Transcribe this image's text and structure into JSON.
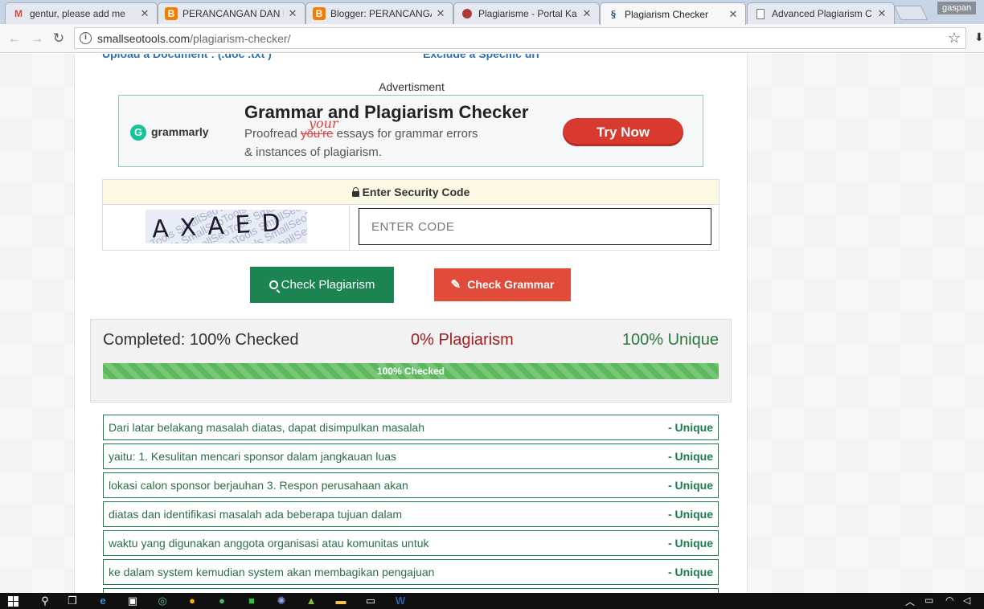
{
  "browser": {
    "tabs": [
      {
        "title": "gentur, please add me",
        "icon": "gmail-icon",
        "active": false
      },
      {
        "title": "PERANCANGAN DAN I",
        "icon": "blogger-icon",
        "active": false
      },
      {
        "title": "Blogger: PERANCANGA",
        "icon": "blogger-icon",
        "active": false
      },
      {
        "title": "Plagiarisme - Portal Ka",
        "icon": "portal-icon",
        "active": false
      },
      {
        "title": "Plagiarism Checker",
        "icon": "smallseotools-icon",
        "active": true
      },
      {
        "title": "Advanced Plagiarism C",
        "icon": "page-icon",
        "active": false
      }
    ],
    "profile_name": "gaspan",
    "url_host": "smallseotools.com",
    "url_path": "/plagiarism-checker/"
  },
  "page": {
    "upload_link": "Upload a Document : (.doc .txt )",
    "exclude_link": "Exclude a Specific url",
    "advert_label": "Advertisment",
    "ad": {
      "brand": "grammarly",
      "logo_letter": "G",
      "headline": "Grammar and Plagiarism Checker",
      "body_start": "Proofread ",
      "struck_word": "you're",
      "handwritten_word": "your",
      "body_end": " essays for grammar errors",
      "body_line2": "& instances of plagiarism.",
      "cta": "Try Now"
    },
    "security": {
      "title": "Enter Security Code",
      "captcha_code": "AXAED",
      "captcha_watermark": "SmallSeoTools",
      "placeholder": "ENTER CODE"
    },
    "buttons": {
      "check_plagiarism": "Check Plagiarism",
      "check_grammar": "Check Grammar"
    },
    "results": {
      "completed": "Completed: 100% Checked",
      "plagiarism": "0% Plagiarism",
      "unique": "100% Unique",
      "progress_label": "100% Checked",
      "progress_percent": 100
    },
    "sentences": [
      {
        "text": "Dari latar belakang masalah diatas, dapat disimpulkan masalah",
        "status": "- Unique"
      },
      {
        "text": "yaitu: 1. Kesulitan mencari sponsor dalam jangkauan luas",
        "status": "- Unique"
      },
      {
        "text": "lokasi calon sponsor berjauhan 3. Respon perusahaan akan",
        "status": "- Unique"
      },
      {
        "text": "diatas dan identifikasi masalah ada beberapa tujuan dalam",
        "status": "- Unique"
      },
      {
        "text": "waktu yang digunakan anggota organisasi atau komunitas untuk",
        "status": "- Unique"
      },
      {
        "text": "ke dalam system kemudian system akan membagikan pengajuan",
        "status": "- Unique"
      },
      {
        "text": "",
        "status": ""
      }
    ]
  },
  "colors": {
    "check_plagiarism_bg": "#1c8450",
    "check_grammar_bg": "#e04b3a",
    "plagiarism_text": "#a51d1d",
    "unique_text": "#2a7a3b",
    "progress_fill": "#5cb85c"
  }
}
